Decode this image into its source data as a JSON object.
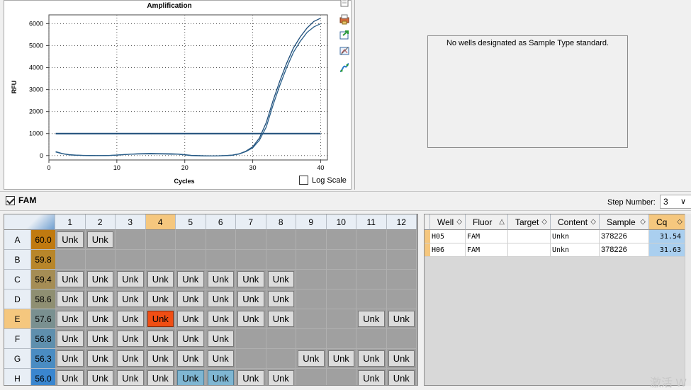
{
  "chart": {
    "title": "Amplification",
    "xlabel": "Cycles",
    "ylabel": "RFU",
    "log_scale_label": "Log Scale",
    "log_scale_checked": false
  },
  "chart_data": {
    "type": "line",
    "title": "Amplification",
    "xlabel": "Cycles",
    "ylabel": "RFU",
    "xlim": [
      0,
      41
    ],
    "ylim": [
      -200,
      6400
    ],
    "x_ticks": [
      0,
      10,
      20,
      30,
      40
    ],
    "y_ticks": [
      0,
      1000,
      2000,
      3000,
      4000,
      5000,
      6000
    ],
    "grid": true,
    "threshold": 1000,
    "series": [
      {
        "x": [
          1,
          2,
          3,
          4,
          5,
          6,
          7,
          8,
          9,
          10,
          11,
          12,
          13,
          14,
          15,
          16,
          17,
          18,
          19,
          20,
          21,
          22,
          23,
          24,
          25,
          26,
          27,
          28,
          29,
          30,
          31,
          32,
          33,
          34,
          35,
          36,
          37,
          38,
          39,
          40
        ],
        "values": [
          180,
          90,
          40,
          20,
          10,
          5,
          0,
          0,
          5,
          20,
          40,
          60,
          80,
          90,
          95,
          90,
          85,
          80,
          70,
          40,
          10,
          0,
          -10,
          -20,
          -10,
          0,
          20,
          80,
          200,
          400,
          800,
          1500,
          2500,
          3400,
          4200,
          4900,
          5400,
          5800,
          6100,
          6250
        ]
      },
      {
        "x": [
          1,
          2,
          3,
          4,
          5,
          6,
          7,
          8,
          9,
          10,
          11,
          12,
          13,
          14,
          15,
          16,
          17,
          18,
          19,
          20,
          21,
          22,
          23,
          24,
          25,
          26,
          27,
          28,
          29,
          30,
          31,
          32,
          33,
          34,
          35,
          36,
          37,
          38,
          39,
          40
        ],
        "values": [
          160,
          80,
          30,
          15,
          5,
          0,
          -5,
          0,
          10,
          25,
          45,
          60,
          70,
          75,
          80,
          75,
          70,
          65,
          60,
          30,
          0,
          -10,
          -15,
          -20,
          -10,
          0,
          15,
          70,
          180,
          350,
          700,
          1300,
          2300,
          3200,
          4000,
          4700,
          5200,
          5600,
          5850,
          6000
        ]
      }
    ]
  },
  "std_curve": {
    "message": "No wells designated as Sample Type standard."
  },
  "fluor_toggle": {
    "label": "FAM",
    "checked": true
  },
  "step": {
    "label": "Step Number:",
    "value": "3"
  },
  "plate": {
    "columns": [
      "1",
      "2",
      "3",
      "4",
      "5",
      "6",
      "7",
      "8",
      "9",
      "10",
      "11",
      "12"
    ],
    "rows": [
      {
        "label": "A",
        "temp": "60.0",
        "temp_color": "#c07a10",
        "wells": [
          "Unk",
          "Unk",
          "",
          "",
          "",
          "",
          "",
          "",
          "",
          "",
          "",
          ""
        ]
      },
      {
        "label": "B",
        "temp": "59.8",
        "temp_color": "#b8862a",
        "wells": [
          "",
          "",
          "",
          "",
          "",
          "",
          "",
          "",
          "",
          "",
          "",
          ""
        ]
      },
      {
        "label": "C",
        "temp": "59.4",
        "temp_color": "#a58d55",
        "wells": [
          "Unk",
          "Unk",
          "Unk",
          "Unk",
          "Unk",
          "Unk",
          "Unk",
          "Unk",
          "",
          "",
          "",
          ""
        ]
      },
      {
        "label": "D",
        "temp": "58.6",
        "temp_color": "#8f8f72",
        "wells": [
          "Unk",
          "Unk",
          "Unk",
          "Unk",
          "Unk",
          "Unk",
          "Unk",
          "Unk",
          "",
          "",
          "",
          ""
        ]
      },
      {
        "label": "E",
        "temp": "57.6",
        "temp_color": "#7a9090",
        "wells": [
          "Unk",
          "Unk",
          "Unk",
          "Unk",
          "Unk",
          "Unk",
          "Unk",
          "Unk",
          "",
          "",
          "Unk",
          "Unk"
        ]
      },
      {
        "label": "F",
        "temp": "56.8",
        "temp_color": "#5f8fad",
        "wells": [
          "Unk",
          "Unk",
          "Unk",
          "Unk",
          "Unk",
          "Unk",
          "",
          "",
          "",
          "",
          "",
          ""
        ]
      },
      {
        "label": "G",
        "temp": "56.3",
        "temp_color": "#4a8cc2",
        "wells": [
          "Unk",
          "Unk",
          "Unk",
          "Unk",
          "Unk",
          "Unk",
          "",
          "",
          "Unk",
          "Unk",
          "Unk",
          "Unk"
        ]
      },
      {
        "label": "H",
        "temp": "56.0",
        "temp_color": "#3a86cf",
        "wells": [
          "Unk",
          "Unk",
          "Unk",
          "Unk",
          "Unk",
          "Unk",
          "Unk",
          "Unk",
          "",
          "",
          "Unk",
          "Unk"
        ]
      }
    ],
    "selected_column": "4",
    "selected_row": "E",
    "highlight_well": "E4",
    "selected_wells": [
      "H5",
      "H6"
    ]
  },
  "results": {
    "headers": [
      "Well",
      "Fluor",
      "Target",
      "Content",
      "Sample",
      "Cq"
    ],
    "rows": [
      {
        "well": "H05",
        "fluor": "FAM",
        "target": "",
        "content": "Unkn",
        "sample": "378226",
        "cq": "31.54"
      },
      {
        "well": "H06",
        "fluor": "FAM",
        "target": "",
        "content": "Unkn",
        "sample": "378226",
        "cq": "31.63"
      }
    ]
  },
  "watermark": "激活 W"
}
